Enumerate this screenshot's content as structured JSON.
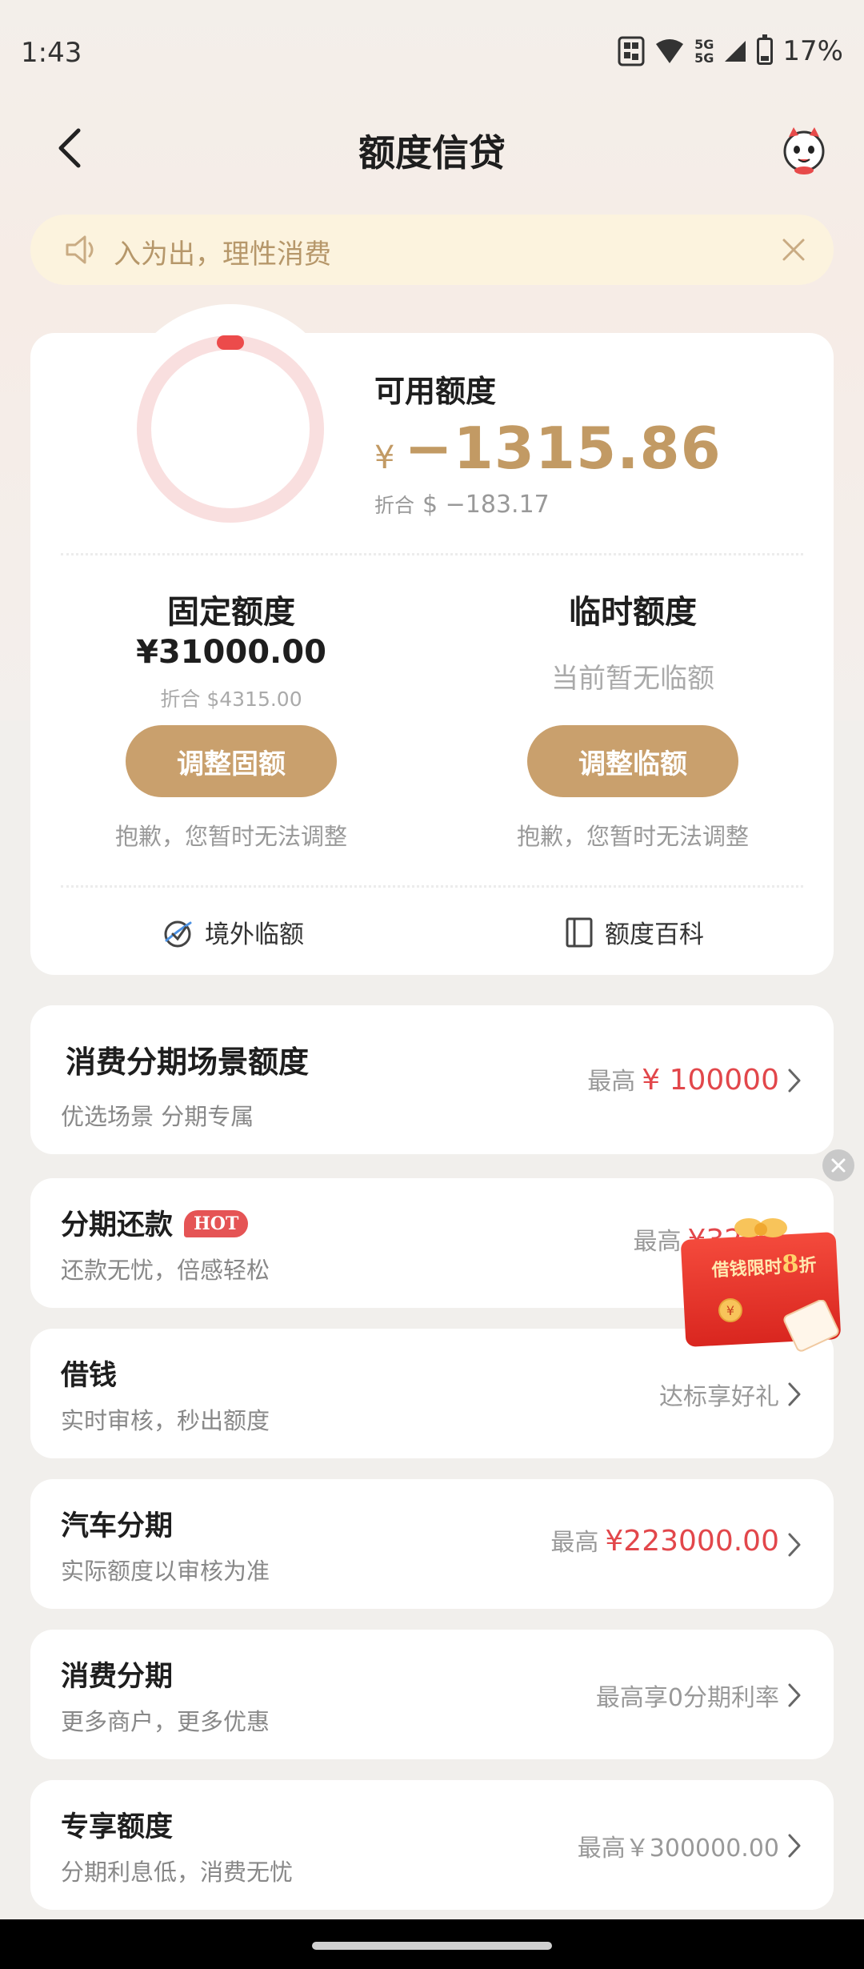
{
  "status_bar": {
    "time": "1:43",
    "network_1": "5G",
    "network_2": "5G",
    "battery": "17%"
  },
  "nav": {
    "title": "额度信贷",
    "back_icon": "chevron-left-icon",
    "mascot_icon": "mascot-icon"
  },
  "notice": {
    "text": "入为出，理性消费",
    "icon": "speaker-icon",
    "close_icon": "close-icon"
  },
  "credit": {
    "available_label": "可用额度",
    "available_currency": "¥",
    "available_amount": "−1315.86",
    "converted_label": "折合",
    "converted_amount": "$ −183.17",
    "ring_colors": {
      "track": "#f9dfdf",
      "indicator": "#ec4b4b"
    },
    "fixed": {
      "title": "固定额度",
      "amount": "¥31000.00",
      "converted": "折合 $4315.00",
      "button": "调整固额",
      "note": "抱歉，您暂时无法调整"
    },
    "temporary": {
      "title": "临时额度",
      "status": "当前暂无临额",
      "button": "调整临额",
      "note": "抱歉，您暂时无法调整"
    },
    "links": {
      "overseas": "境外临额",
      "wiki": "额度百科"
    }
  },
  "list": [
    {
      "title": "消费分期场景额度",
      "subtitle": "优选场景 分期专属",
      "prefix": "最高",
      "value": "¥ 100000"
    },
    {
      "title": "分期还款",
      "badge": "HOT",
      "subtitle": "还款无忧，倍感轻松",
      "prefix": "最高",
      "value": "¥3227"
    },
    {
      "title": "借钱",
      "subtitle": "实时审核，秒出额度",
      "text": "达标享好礼"
    },
    {
      "title": "汽车分期",
      "subtitle": "实际额度以审核为准",
      "prefix": "最高",
      "value": "¥223000.00"
    },
    {
      "title": "消费分期",
      "subtitle": "更多商户，更多优惠",
      "text": "最高享0分期利率"
    },
    {
      "title": "专享额度",
      "subtitle": "分期利息低，消费无忧",
      "text": "最高￥300000.00"
    }
  ],
  "promo": {
    "text_a": "借钱限时",
    "text_b": "8",
    "text_c": "折"
  },
  "colors": {
    "accent_gold": "#c9a06d",
    "amount_gold": "#c29a64",
    "red": "#e2474b",
    "notice_bg": "#fcf3de"
  }
}
